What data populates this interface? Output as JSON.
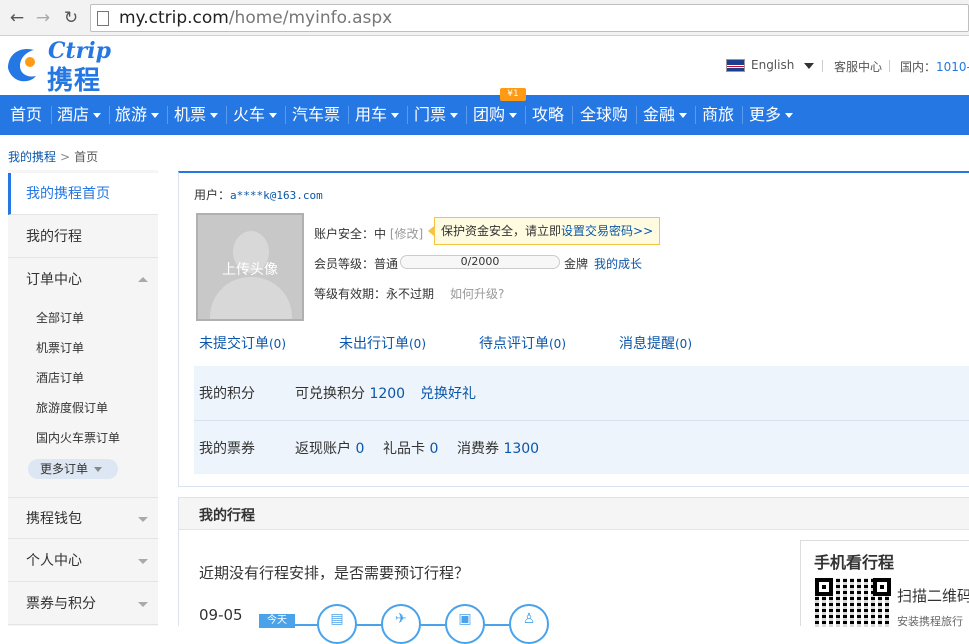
{
  "browser": {
    "url_host": "my.ctrip.com",
    "url_path": "/home/myinfo.aspx"
  },
  "header": {
    "logo_en": "Ctrip",
    "logo_cn": "携程",
    "language": "English",
    "service_center": "客服中心",
    "hotline_label": "国内：",
    "hotline_number": "1010-"
  },
  "nav": {
    "badge": "¥1",
    "items": [
      {
        "label": "首页",
        "dropdown": false
      },
      {
        "label": "酒店",
        "dropdown": true
      },
      {
        "label": "旅游",
        "dropdown": true
      },
      {
        "label": "机票",
        "dropdown": true
      },
      {
        "label": "火车",
        "dropdown": true
      },
      {
        "label": "汽车票",
        "dropdown": false
      },
      {
        "label": "用车",
        "dropdown": true
      },
      {
        "label": "门票",
        "dropdown": true
      },
      {
        "label": "团购",
        "dropdown": true
      },
      {
        "label": "攻略",
        "dropdown": false
      },
      {
        "label": "全球购",
        "dropdown": false
      },
      {
        "label": "金融",
        "dropdown": true
      },
      {
        "label": "商旅",
        "dropdown": false
      },
      {
        "label": "更多",
        "dropdown": true
      }
    ]
  },
  "breadcrumb": {
    "parent": "我的携程",
    "separator": ">",
    "current": "首页"
  },
  "sidebar": {
    "home": "我的携程首页",
    "itinerary": "我的行程",
    "orders": "订单中心",
    "order_links": [
      "全部订单",
      "机票订单",
      "酒店订单",
      "旅游度假订单",
      "国内火车票订单"
    ],
    "more_orders": "更多订单",
    "wallet": "携程钱包",
    "personal": "个人中心",
    "coupons": "票券与积分"
  },
  "account": {
    "user_label": "用户：",
    "user_email": "a****k@163.com",
    "avatar_label": "上传头像",
    "security_label": "账户安全：",
    "security_level": "中",
    "modify_link": "[修改]",
    "security_tip_text": "保护资金安全，请立即",
    "security_tip_link": "设置交易密码>>",
    "member_label": "会员等级：",
    "member_level": "普通",
    "progress": "0/2000",
    "progress_fraction": 0,
    "next_level": "金牌",
    "growth_link": "我的成长",
    "validity_label": "等级有效期：",
    "validity_value": "永不过期",
    "upgrade_link": "如何升级?"
  },
  "order_tabs": [
    {
      "label": "未提交订单",
      "count": "(0)"
    },
    {
      "label": "未出行订单",
      "count": "(0)"
    },
    {
      "label": "待点评订单",
      "count": "(0)"
    },
    {
      "label": "消息提醒",
      "count": "(0)"
    }
  ],
  "points": {
    "title": "我的积分",
    "redeemable_label": "可兑换积分",
    "redeemable_value": "1200",
    "redeem_link": "兑换好礼"
  },
  "vouchers": {
    "title": "我的票券",
    "cashback_label": "返现账户",
    "cashback_value": "0",
    "giftcard_label": "礼品卡",
    "giftcard_value": "0",
    "consume_label": "消费券",
    "consume_value": "1300"
  },
  "trip": {
    "title": "我的行程",
    "question": "近期没有行程安排，是否需要预订行程？",
    "date": "09-05",
    "today_tag": "今天"
  },
  "mobile": {
    "title": "手机看行程",
    "scan": "扫描二维码",
    "install": "安装携程旅行"
  },
  "colors": {
    "brand_blue": "#2577e3",
    "link_blue": "#0b56a8",
    "badge_orange": "#ff9a14"
  }
}
